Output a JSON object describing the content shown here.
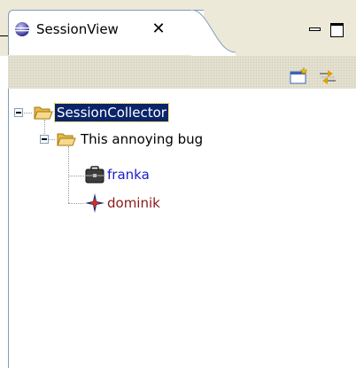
{
  "view": {
    "title": "SessionView",
    "close_glyph": "✕"
  },
  "toolbar": {
    "buttons": [
      {
        "name": "new-session-icon"
      },
      {
        "name": "synchronize-icon"
      }
    ]
  },
  "tree": {
    "root": {
      "label": "SessionCollector",
      "icon": "open-folder-icon",
      "selected": true
    },
    "child": {
      "label": "This annoying bug",
      "icon": "open-folder-icon"
    },
    "participants": [
      {
        "label": "franka",
        "icon": "briefcase-icon",
        "color": "#1b1bcf"
      },
      {
        "label": "dominik",
        "icon": "compass-star-icon",
        "color": "#8a1818"
      }
    ]
  },
  "colors": {
    "selection_bg": "#0a246a",
    "selection_fg": "#ffffff"
  }
}
